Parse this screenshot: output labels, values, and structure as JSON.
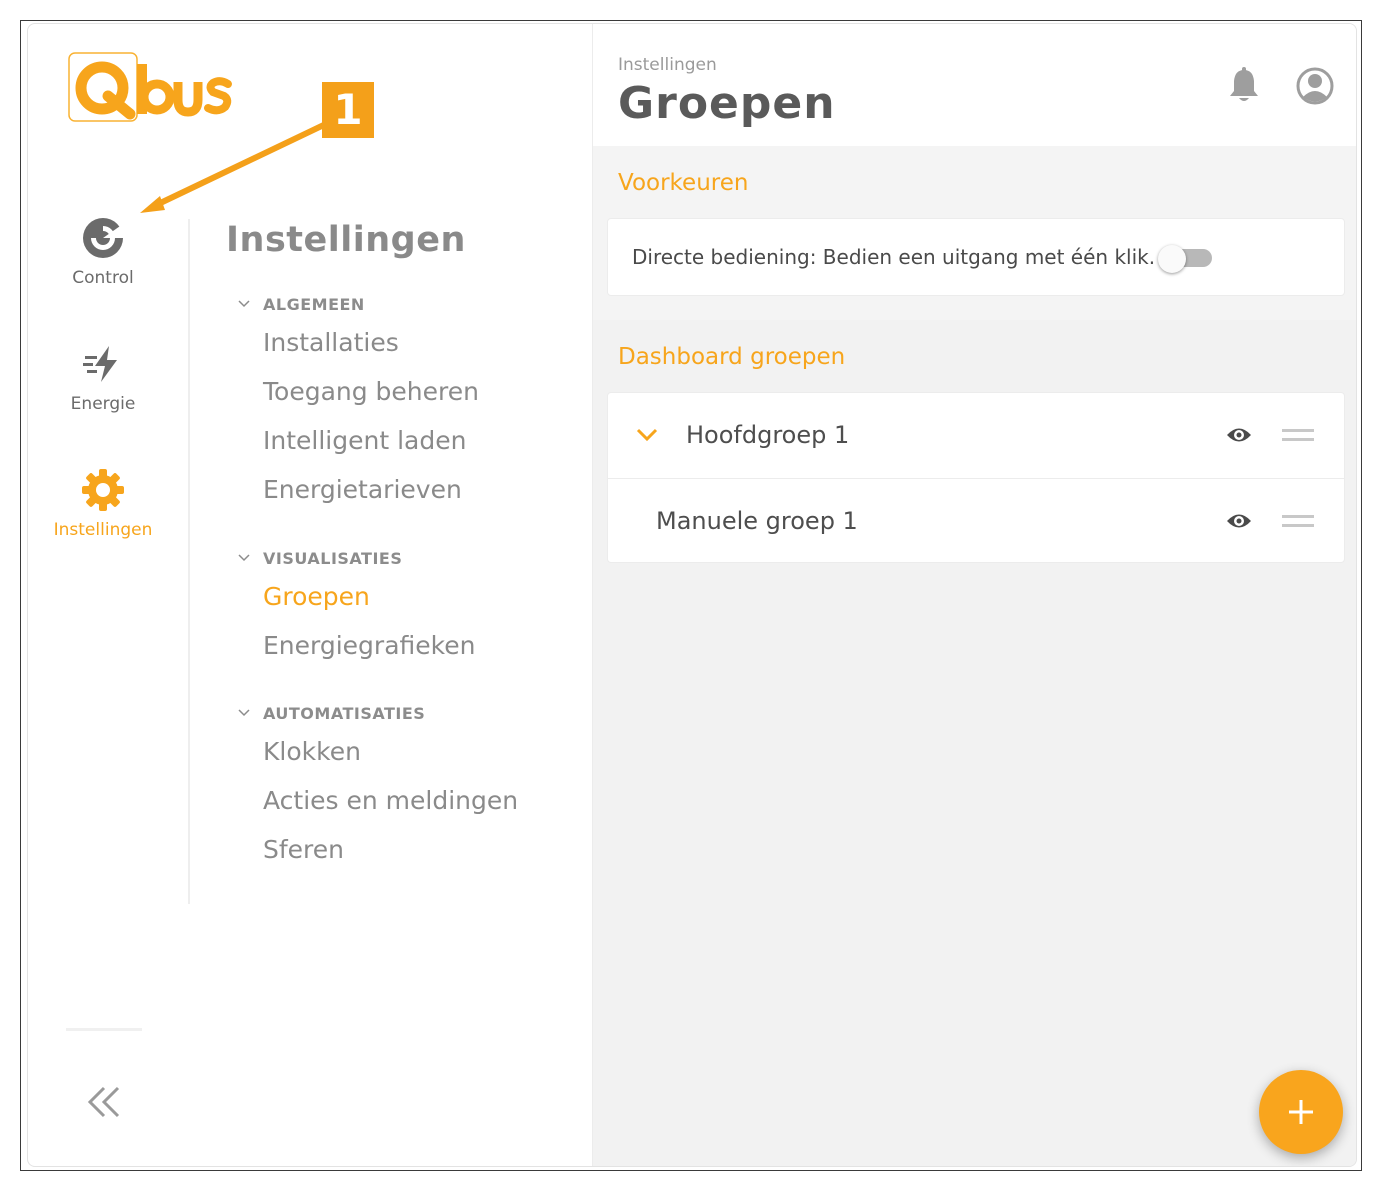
{
  "brand": {
    "name": "Qbus",
    "accent": "#f7a51c"
  },
  "rail": {
    "items": [
      {
        "label": "Control",
        "icon": "control-icon"
      },
      {
        "label": "Energie",
        "icon": "energy-icon"
      },
      {
        "label": "Instellingen",
        "icon": "gear-icon",
        "active": true
      }
    ],
    "collapse_icon": "double-chevron-left-icon"
  },
  "menu": {
    "title": "Instellingen",
    "sections": [
      {
        "label": "ALGEMEEN",
        "items": [
          "Installaties",
          "Toegang beheren",
          "Intelligent laden",
          "Energietarieven"
        ]
      },
      {
        "label": "VISUALISATIES",
        "items": [
          "Groepen",
          "Energiegrafieken"
        ],
        "active_item": "Groepen"
      },
      {
        "label": "AUTOMATISATIES",
        "items": [
          "Klokken",
          "Acties en meldingen",
          "Sferen"
        ]
      }
    ]
  },
  "header": {
    "breadcrumb": "Instellingen",
    "title": "Groepen",
    "icons": [
      "bell-icon",
      "user-icon"
    ]
  },
  "preferences": {
    "title": "Voorkeuren",
    "direct_control_label": "Directe bediening: Bedien een uitgang met één klik.",
    "direct_control_enabled": false
  },
  "dashboard": {
    "title": "Dashboard groepen",
    "groups": [
      {
        "name": "Hoofdgroep 1",
        "expanded": true,
        "visible": true
      },
      {
        "name": "Manuele groep 1",
        "visible": true
      }
    ]
  },
  "fab": {
    "icon": "plus-icon"
  },
  "annotation": {
    "number": "1"
  }
}
